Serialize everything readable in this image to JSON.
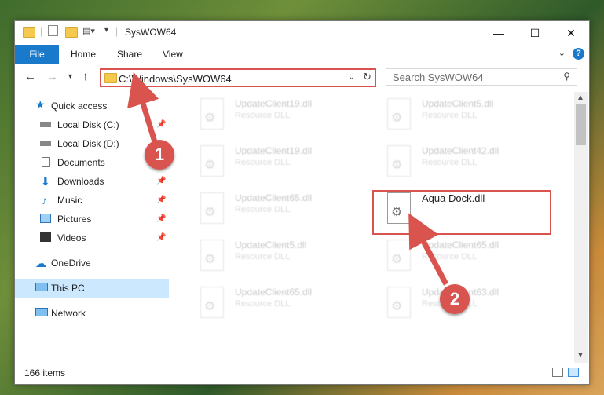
{
  "window": {
    "title": "SysWOW64",
    "controls": {
      "minimize": "—",
      "maximize": "☐",
      "close": "✕"
    }
  },
  "ribbon": {
    "tabs": [
      "File",
      "Home",
      "Share",
      "View"
    ],
    "help": "?"
  },
  "nav": {
    "address": "C:\\Windows\\SysWOW64",
    "search_placeholder": "Search SysWOW64"
  },
  "sidebar": {
    "items": [
      {
        "label": "Quick access",
        "icon": "star-icon",
        "pinned": false
      },
      {
        "label": "Local Disk (C:)",
        "icon": "drive-icon",
        "pinned": true
      },
      {
        "label": "Local Disk (D:)",
        "icon": "drive-icon",
        "pinned": false
      },
      {
        "label": "Documents",
        "icon": "document-icon",
        "pinned": true
      },
      {
        "label": "Downloads",
        "icon": "download-icon",
        "pinned": true
      },
      {
        "label": "Music",
        "icon": "music-icon",
        "pinned": true
      },
      {
        "label": "Pictures",
        "icon": "picture-icon",
        "pinned": true
      },
      {
        "label": "Videos",
        "icon": "video-icon",
        "pinned": true
      },
      {
        "label": "OneDrive",
        "icon": "cloud-icon",
        "pinned": false
      },
      {
        "label": "This PC",
        "icon": "computer-icon",
        "pinned": false
      },
      {
        "label": "Network",
        "icon": "network-icon",
        "pinned": false
      }
    ]
  },
  "files": [
    {
      "name": "UpdateClient19.dll",
      "type": "Resource DLL"
    },
    {
      "name": "UpdateClient5.dll",
      "type": "Resource DLL"
    },
    {
      "name": "UpdateClient19.dll",
      "type": "Resource DLL"
    },
    {
      "name": "UpdateClient42.dll",
      "type": "Resource DLL"
    },
    {
      "name": "UpdateClient65.dll",
      "type": "Resource DLL"
    },
    {
      "name": "Aqua Dock.dll",
      "type": ""
    },
    {
      "name": "UpdateClient5.dll",
      "type": "Resource DLL"
    },
    {
      "name": "UpdateClient65.dll",
      "type": "Resource DLL"
    },
    {
      "name": "UpdateClient65.dll",
      "type": "Resource DLL"
    },
    {
      "name": "UpdateClient63.dll",
      "type": "Resource DLL"
    }
  ],
  "status": {
    "item_count": "166 items"
  },
  "annotations": {
    "step1": "1",
    "step2": "2",
    "color": "#d9534f"
  }
}
